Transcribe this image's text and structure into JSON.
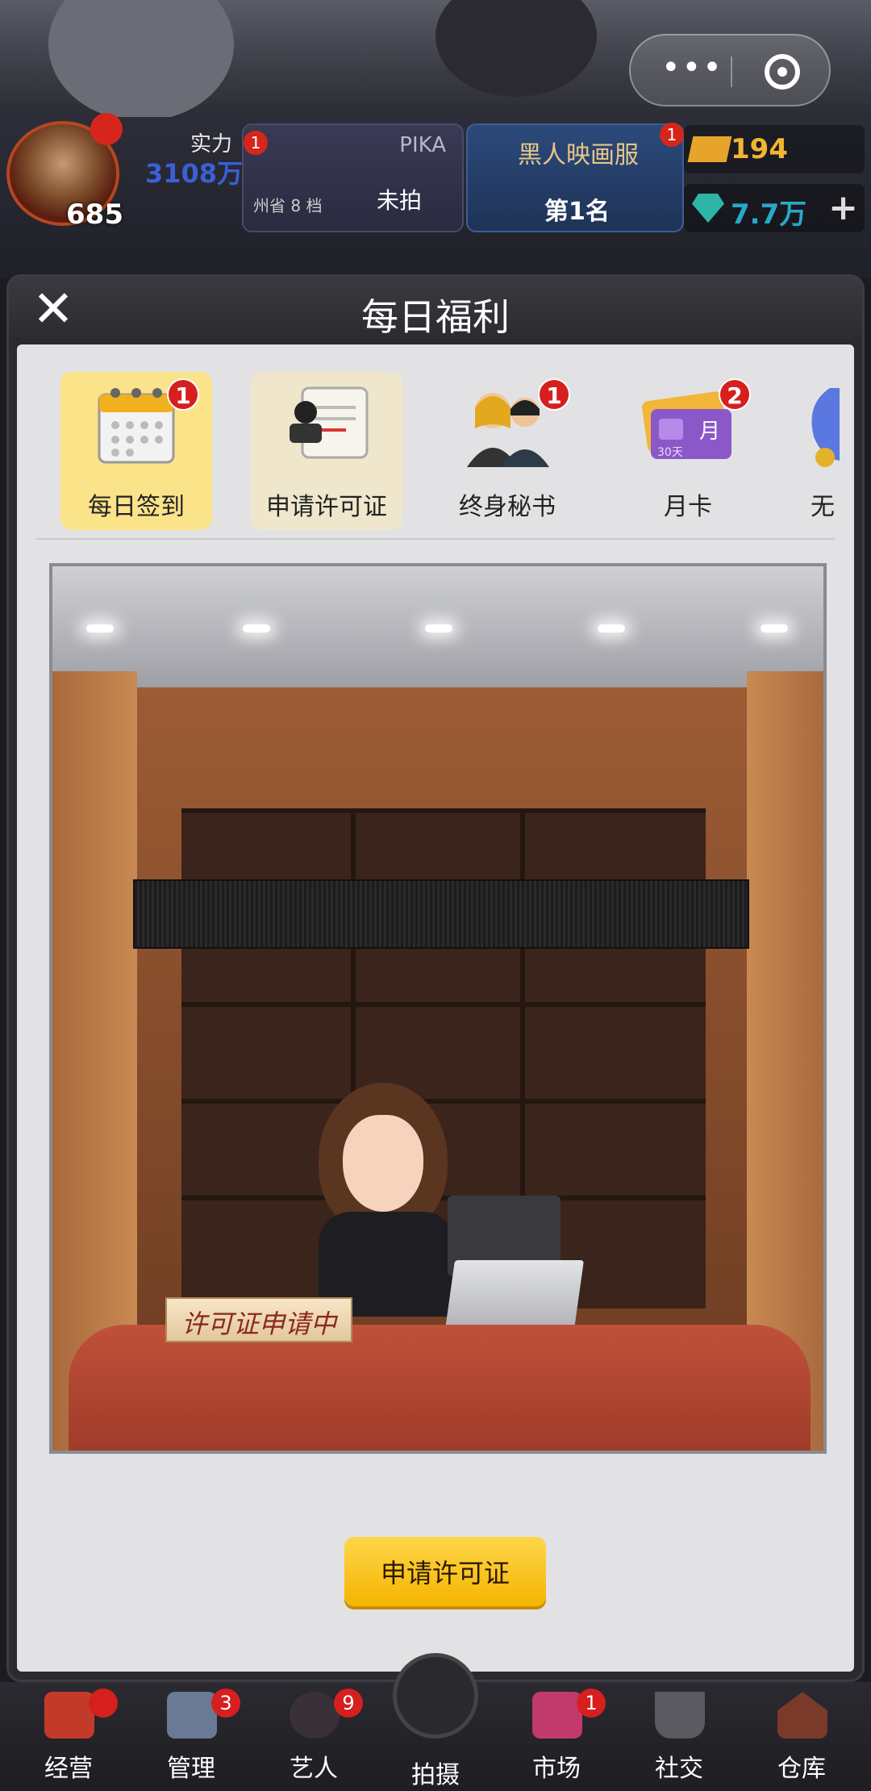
{
  "hud": {
    "level": "685",
    "power_label": "实力",
    "power_value": "3108万",
    "avatar_badge": "",
    "card_pika": {
      "name": "PIKA",
      "status": "未拍",
      "tier": "州省 8 档",
      "badge": "1"
    },
    "card_ranking": {
      "name": "黑人映画服",
      "rank": "第1名",
      "badge": "1"
    },
    "gold": "194",
    "gems": "7.7万",
    "plus": "+"
  },
  "capsule": {
    "more_icon": "more-dots-icon",
    "close_icon": "target-circle-icon"
  },
  "modal": {
    "title": "每日福利",
    "close_icon": "close-x-icon",
    "tabs": [
      {
        "label": "每日签到",
        "icon": "calendar-icon",
        "badge": "1",
        "state": "active"
      },
      {
        "label": "申请许可证",
        "icon": "license-scroll-icon",
        "badge": "",
        "state": "selected"
      },
      {
        "label": "终身秘书",
        "icon": "secretary-people-icon",
        "badge": "1",
        "state": "normal"
      },
      {
        "label": "月卡",
        "icon": "month-card-icon",
        "badge": "2",
        "state": "normal"
      },
      {
        "label": "无",
        "icon": "trophy-icon",
        "badge": "",
        "state": "normal"
      }
    ],
    "month_card_text": {
      "month": "月",
      "days": "30天"
    },
    "scene": {
      "nameplate": "许可证申请中"
    },
    "apply_button": "申请许可证"
  },
  "bottom_nav": [
    {
      "label": "经营",
      "icon": "popcorn-icon",
      "badge": ""
    },
    {
      "label": "管理",
      "icon": "manage-icon",
      "badge": "3"
    },
    {
      "label": "艺人",
      "icon": "artist-icon",
      "badge": "9"
    },
    {
      "label": "拍摄",
      "icon": "film-reel-icon",
      "badge": ""
    },
    {
      "label": "市场",
      "icon": "market-icon",
      "badge": "1"
    },
    {
      "label": "社交",
      "icon": "coffee-cup-icon",
      "badge": ""
    },
    {
      "label": "仓库",
      "icon": "warehouse-icon",
      "badge": ""
    }
  ],
  "colors": {
    "active_tab": "#fbe38a",
    "button": "#f5b400",
    "badge": "#d61f1f",
    "gold": "#f3b530",
    "gem": "#29a8c8"
  }
}
